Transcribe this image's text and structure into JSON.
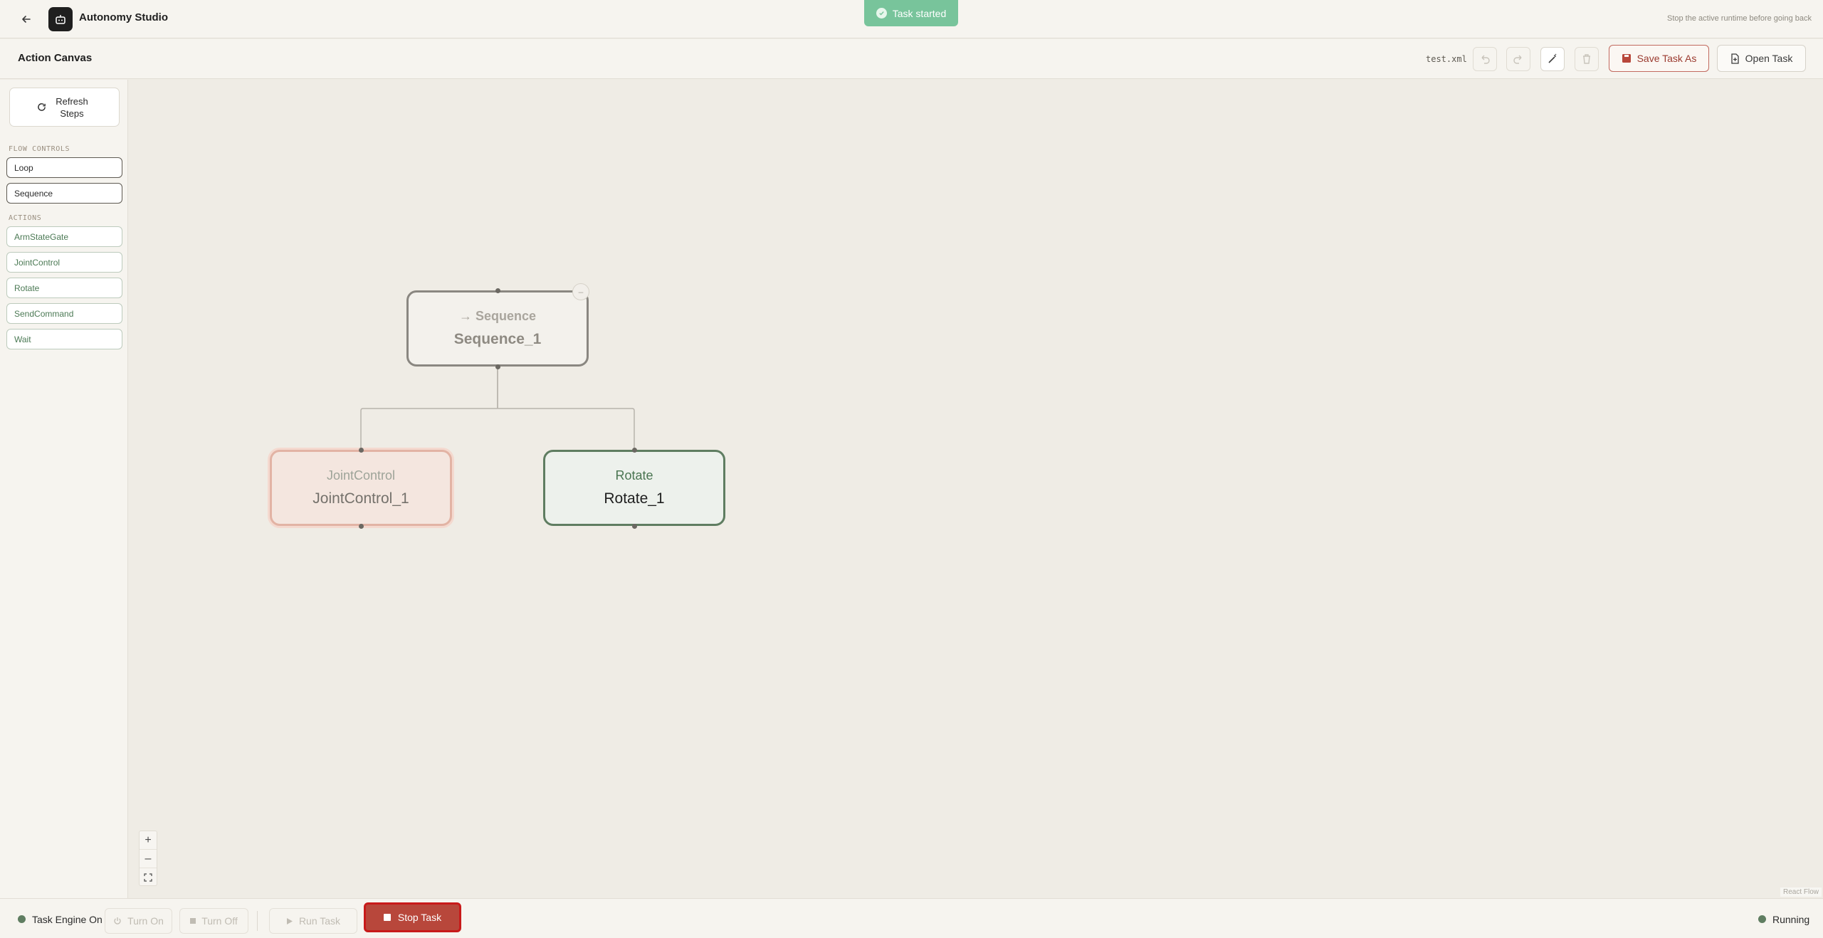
{
  "app": {
    "title": "Autonomy Studio",
    "hint": "Stop the active runtime before going back"
  },
  "toast": {
    "text": "Task started",
    "color": "#78c49b"
  },
  "toolbar": {
    "title": "Action Canvas",
    "filename": "test.xml",
    "save_label": "Save Task As",
    "open_label": "Open Task"
  },
  "sidebar": {
    "refresh_label": "Refresh Steps",
    "flow_label": "FLOW CONTROLS",
    "flow_items": [
      "Loop",
      "Sequence"
    ],
    "actions_label": "ACTIONS",
    "action_items": [
      "ArmStateGate",
      "JointControl",
      "Rotate",
      "SendCommand",
      "Wait"
    ]
  },
  "canvas": {
    "nodes": [
      {
        "type": "→ Sequence",
        "name": "Sequence_1"
      },
      {
        "type": "JointControl",
        "name": "JointControl_1"
      },
      {
        "type": "Rotate",
        "name": "Rotate_1"
      }
    ],
    "collapse_symbol": "–",
    "attribution": "React Flow"
  },
  "footer": {
    "engine_label": "Task Engine On",
    "turn_on": "Turn On",
    "turn_off": "Turn Off",
    "run_task": "Run Task",
    "stop_task": "Stop Task",
    "status": "Running",
    "status_color": "#5f7d61"
  },
  "colors": {
    "accent": "#9b3a2f",
    "stop": "#b8473b",
    "action_green": "#4c7a55"
  }
}
